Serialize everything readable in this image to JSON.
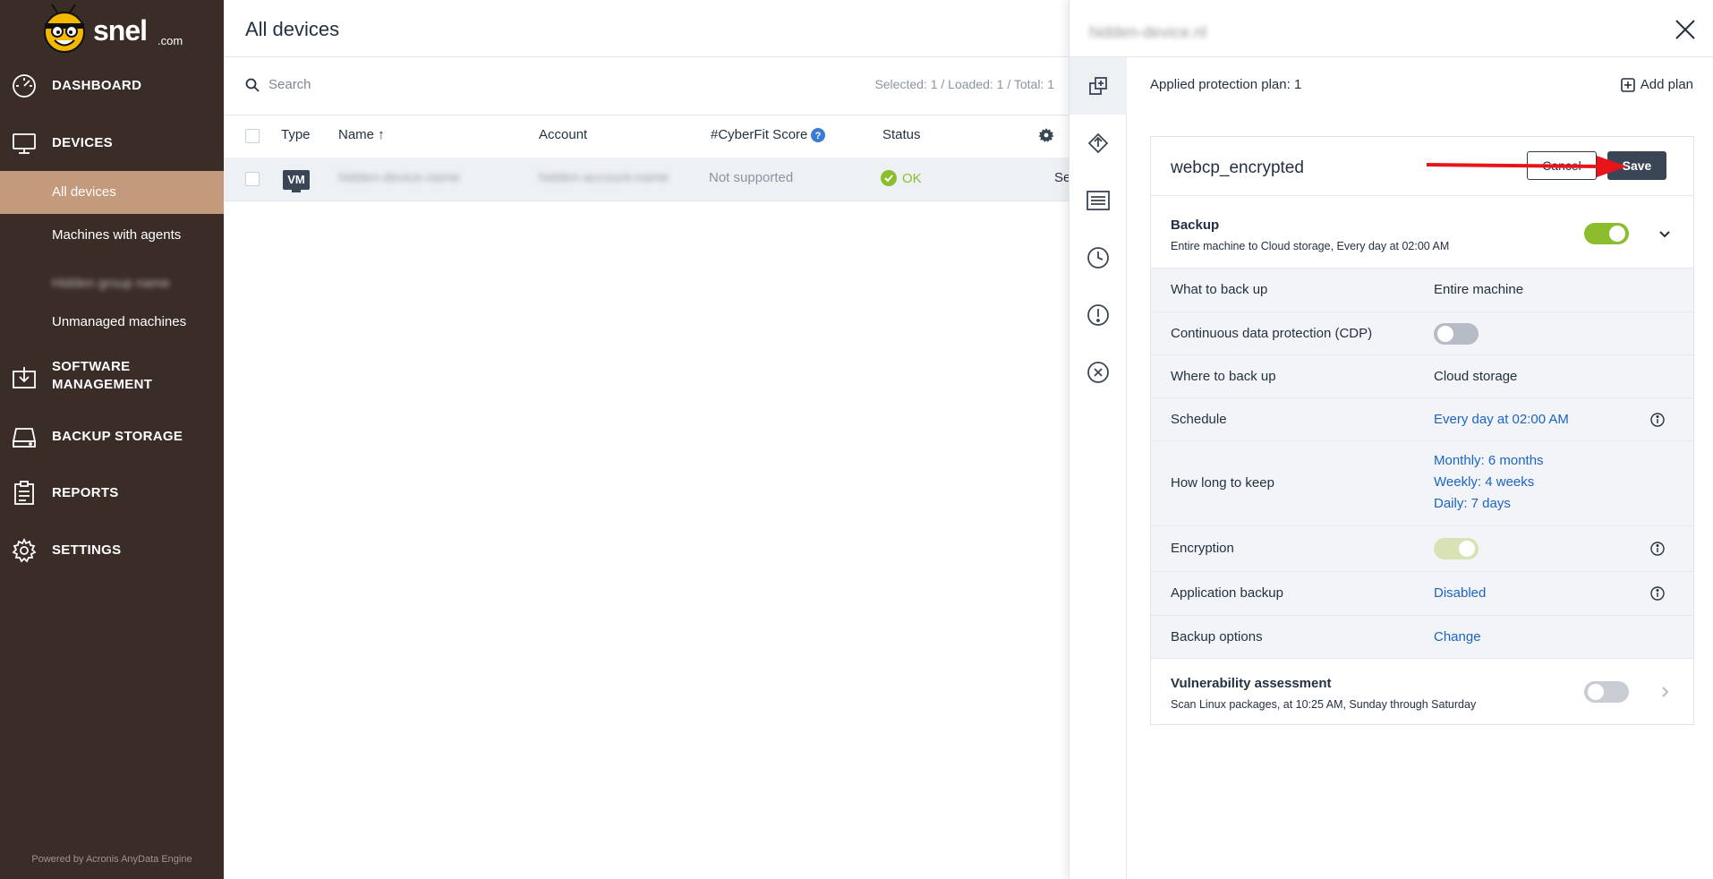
{
  "brand": {
    "word": "snel",
    "suffix": ".com"
  },
  "sidebar": {
    "nav": {
      "dashboard": "DASHBOARD",
      "devices": "DEVICES",
      "software_line1": "SOFTWARE",
      "software_line2": "MANAGEMENT",
      "backup_storage": "BACKUP STORAGE",
      "reports": "REPORTS",
      "settings": "SETTINGS"
    },
    "sub": {
      "all_devices": "All devices",
      "machines_with_agents": "Machines with agents",
      "blurred_group": "Hidden group name",
      "unmanaged": "Unmanaged machines"
    },
    "powered_by": "Powered by Acronis AnyData Engine"
  },
  "main": {
    "title": "All devices",
    "search_placeholder": "Search",
    "counts": "Selected: 1 / Loaded: 1 / Total: 1",
    "columns": {
      "type": "Type",
      "name": "Name ↑",
      "account": "Account",
      "cyberfit": "#CyberFit Score",
      "status": "Status"
    },
    "row": {
      "type": "VM",
      "name": "hidden-device-name",
      "account": "hidden-account-name",
      "cyberfit": "Not supported",
      "status": "OK",
      "extra": "Se"
    }
  },
  "panel": {
    "title": "hidden-device.nl",
    "applied": "Applied protection plan: 1",
    "add_plan": "Add plan",
    "plan_name": "webcp_encrypted",
    "cancel": "Cancel",
    "save": "Save",
    "backup": {
      "title": "Backup",
      "subtitle": "Entire machine to Cloud storage, Every day at 02:00 AM",
      "rows": {
        "what_k": "What to back up",
        "what_v": "Entire machine",
        "cdp_k": "Continuous data protection (CDP)",
        "where_k": "Where to back up",
        "where_v": "Cloud storage",
        "schedule_k": "Schedule",
        "schedule_v": "Every day at 02:00 AM",
        "keep_k": "How long to keep",
        "keep_monthly": "Monthly: 6 months",
        "keep_weekly": "Weekly: 4 weeks",
        "keep_daily": "Daily: 7 days",
        "encryption_k": "Encryption",
        "app_k": "Application backup",
        "app_v": "Disabled",
        "options_k": "Backup options",
        "options_v": "Change"
      }
    },
    "vuln": {
      "title": "Vulnerability assessment",
      "subtitle": "Scan Linux packages, at 10:25 AM, Sunday through Saturday"
    }
  },
  "colors": {
    "sidebar_bg": "#3a2c26",
    "active_item": "#c49a7d",
    "toggle_on": "#8bbd2c",
    "link": "#1c64c4",
    "ok": "#8bbd2c",
    "annotation_arrow": "#e8141a"
  }
}
